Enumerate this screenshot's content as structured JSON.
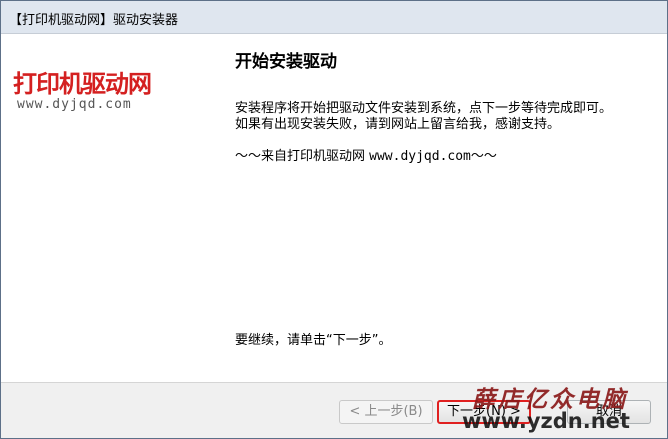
{
  "window": {
    "title": "【打印机驱动网】驱动安装器"
  },
  "logo": {
    "name": "打印机驱动网",
    "url": "www.dyjqd.com"
  },
  "page": {
    "heading": "开始安装驱动",
    "paragraph1": "安装程序将开始把驱动文件安装到系统，点下一步等待完成即可。",
    "paragraph2": "如果有出现安装失败，请到网站上留言给我，感谢支持。",
    "signature_prefix": "～～来自打印机驱动网 ",
    "signature_url": "www.dyjqd.com",
    "signature_suffix": "～～",
    "continue_prompt": "要继续，请单击“下一步”。"
  },
  "buttons": {
    "back": "< 上一步(B)",
    "next": "下一步(N) >",
    "cancel": "取消"
  },
  "watermark": {
    "cn": "薛店亿众电脑",
    "url": "www.yzdn.net"
  }
}
